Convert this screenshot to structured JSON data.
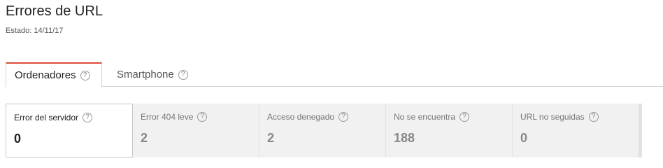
{
  "page": {
    "title": "Errores de URL",
    "status": "Estado: 14/11/17"
  },
  "tabs": [
    {
      "label": "Ordenadores",
      "help": "?"
    },
    {
      "label": "Smartphone",
      "help": "?"
    }
  ],
  "cards": [
    {
      "label": "Error del servidor",
      "value": "0",
      "help": "?"
    },
    {
      "label": "Error 404 leve",
      "value": "2",
      "help": "?"
    },
    {
      "label": "Acceso denegado",
      "value": "2",
      "help": "?"
    },
    {
      "label": "No se encuentra",
      "value": "188",
      "help": "?"
    },
    {
      "label": "URL no seguidas",
      "value": "0",
      "help": "?"
    }
  ],
  "colors": {
    "active_tab_accent": "#dd4b39",
    "card_background": "#f1f1f1"
  },
  "icons": {
    "help": "question-circle-icon"
  }
}
